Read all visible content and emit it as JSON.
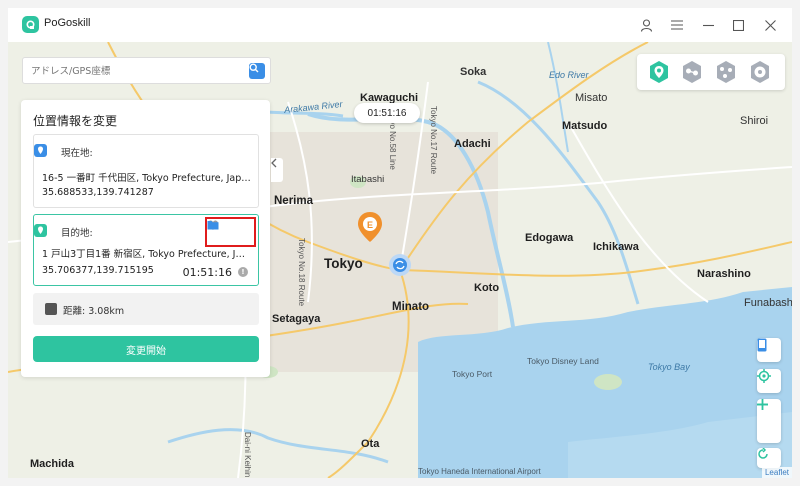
{
  "app": {
    "title": "PoGoskill"
  },
  "search": {
    "placeholder": "アドレス/GPS座標"
  },
  "panel": {
    "title": "位置情報を変更",
    "current": {
      "label": "現在地:",
      "address": "16-5 一番町 千代田区, Tokyo Prefecture, Japan",
      "coords": "35.688533,139.741287"
    },
    "destination": {
      "label": "目的地:",
      "address": "1 戸山3丁目1番 新宿区, Tokyo Prefecture, Ja...",
      "coords": "35.706377,139.715195",
      "time": "01:51:16"
    },
    "distance": "距離: 3.08km",
    "start_button": "変更開始"
  },
  "map": {
    "timer": "01:51:16",
    "attribution": "Leaflet",
    "labels": {
      "soka": "Soka",
      "kawaguchi": "Kawaguchi",
      "edo_river": "Edo River",
      "arakawa_river": "Arakawa River",
      "misato": "Misato",
      "shiroi": "Shiroi",
      "matsudo": "Matsudo",
      "adachi": "Adachi",
      "itabashi": "Itabashi",
      "nerima": "Nerima",
      "ichikawa": "Ichikawa",
      "edogawa": "Edogawa",
      "tokyo": "Tokyo",
      "funabashi": "Funabashi",
      "narashino": "Narashino",
      "koto": "Koto",
      "minato": "Minato",
      "setagaya": "Setagaya",
      "tokyo_disney": "Tokyo Disney Land",
      "tokyo_bay": "Tokyo Bay",
      "tokyo_port": "Tokyo Port",
      "ota": "Ota",
      "machida": "Machida",
      "haneda": "Tokyo Haneda International Airport",
      "tokyo_r17": "Tokyo No.17 Route",
      "tokyo_r18": "Tokyo No.18 Route",
      "tokyo_r58": "Tokyo No.58 Line",
      "dai_r": "Dai-ni Keihin"
    }
  },
  "colors": {
    "accent": "#2ec4a0",
    "highlight": "#e01c1c",
    "water": "#a9d3ee",
    "map_bg": "#eef0e6"
  }
}
